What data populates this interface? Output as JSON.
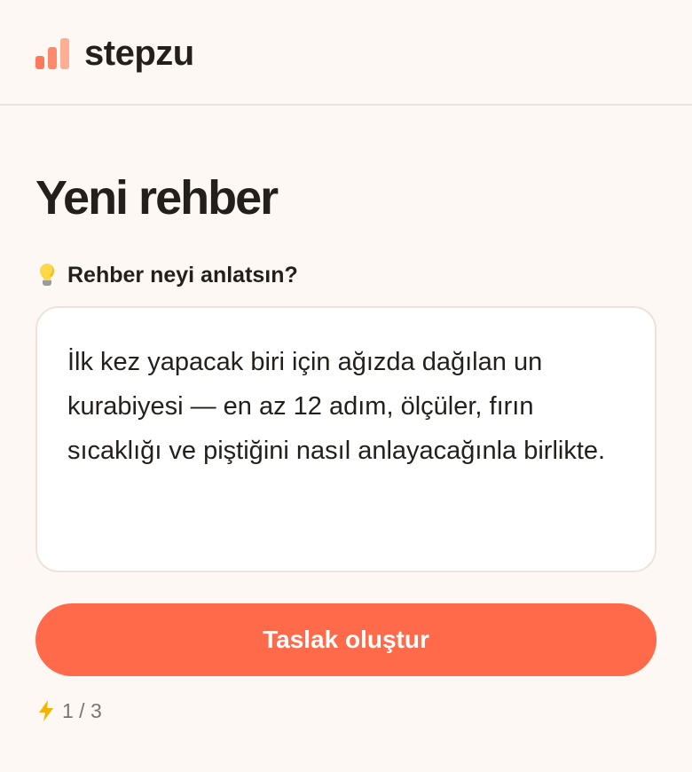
{
  "brand": {
    "name": "stepzu",
    "logo_icon": "bar-chart-logo-icon",
    "accent_color": "#ff6a4a"
  },
  "page": {
    "title": "Yeni rehber"
  },
  "prompt_field": {
    "label": "Rehber neyi anlatsın?",
    "label_icon": "lightbulb-icon",
    "value": "İlk kez yapacak biri için ağızda dağılan un kurabiyesi — en az 12 adım, ölçüler, fırın sıcaklığı ve piştiğini nasıl anlayacağınla birlikte."
  },
  "actions": {
    "create_draft_label": "Taslak oluştur"
  },
  "quota": {
    "icon": "lightning-icon",
    "text": "1 / 3"
  }
}
